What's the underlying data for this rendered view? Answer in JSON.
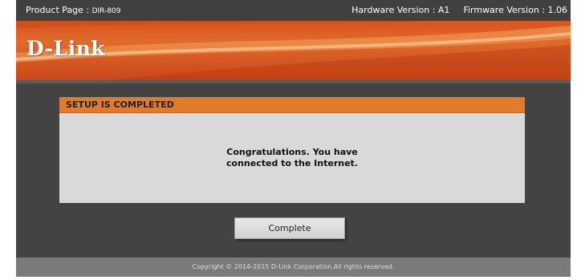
{
  "topbar": {
    "product_label": "Product Page : ",
    "product_model": "DIR-809",
    "hardware_version": "Hardware Version : A1",
    "firmware_version": "Firmware Version : 1.06"
  },
  "banner": {
    "logo_text": "D-Link"
  },
  "panel": {
    "header": "SETUP IS COMPLETED",
    "message_line1": "Congratulations. You have",
    "message_line2": "connected to the Internet."
  },
  "actions": {
    "complete_label": "Complete"
  },
  "footer": {
    "copyright": "Copyright © 2014-2015 D-Link Corporation.All rights reserved."
  },
  "colors": {
    "accent_orange": "#e07b2e",
    "banner_orange": "#d9521c",
    "page_background": "#434343",
    "panel_background": "#d9d9d9"
  }
}
